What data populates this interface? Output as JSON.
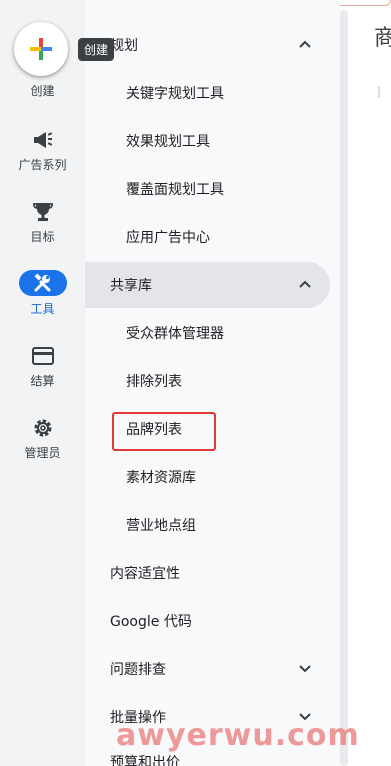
{
  "rail": {
    "create_label": "创建",
    "create_tooltip": "创建",
    "items": [
      {
        "label": "广告系列",
        "icon": "megaphone-icon"
      },
      {
        "label": "目标",
        "icon": "trophy-icon"
      },
      {
        "label": "工具",
        "icon": "tools-icon",
        "active": true
      },
      {
        "label": "结算",
        "icon": "credit-card-icon"
      },
      {
        "label": "管理员",
        "icon": "gear-icon"
      }
    ]
  },
  "nav": {
    "planning_header": "规划",
    "planning_items": [
      "关键字规划工具",
      "效果规划工具",
      "覆盖面规划工具",
      "应用广告中心"
    ],
    "shared_library_header": "共享库",
    "shared_library_items": [
      "受众群体管理器",
      "排除列表",
      "品牌列表",
      "素材资源库",
      "营业地点组"
    ],
    "content_suitability": "内容适宜性",
    "google_tag": "Google 代码",
    "troubleshooting": "问题排查",
    "bulk_actions": "批量操作",
    "budgets_bidding": "预算和出价"
  },
  "main": {
    "title_char": "商"
  },
  "watermark": "awyerwu.com",
  "colors": {
    "accent": "#1a73e8",
    "highlight": "#e53935",
    "rail_bg": "#f1f3f4",
    "nav_bg": "#f8f9fa"
  }
}
